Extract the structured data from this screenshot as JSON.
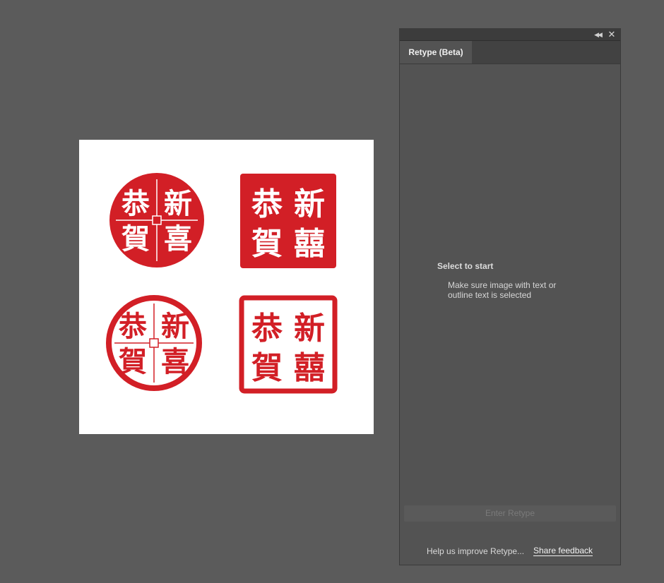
{
  "panel": {
    "tab_label": "Retype (Beta)",
    "collapse_icon": "double-chevron-left-icon",
    "close_icon": "close-icon",
    "empty_state": {
      "title": "Select to start",
      "description": "Make sure image with text or outline text is selected"
    },
    "enter_button_label": "Enter Retype",
    "footer": {
      "help_text": "Help us improve Retype...",
      "feedback_link": "Share feedback"
    }
  },
  "artboard": {
    "seals": [
      {
        "shape": "circle-filled",
        "chars": [
          "新",
          "喜",
          "恭",
          "賀"
        ]
      },
      {
        "shape": "square-filled",
        "chars": [
          "新",
          "囍",
          "恭",
          "賀"
        ]
      },
      {
        "shape": "circle-outline",
        "chars": [
          "新",
          "喜",
          "恭",
          "賀"
        ]
      },
      {
        "shape": "square-outline",
        "chars": [
          "新",
          "囍",
          "恭",
          "賀"
        ]
      }
    ],
    "seal_color": "#d21f26"
  },
  "colors": {
    "workspace": "#5b5b5b",
    "panel": "#535353",
    "artboard": "#ffffff"
  }
}
